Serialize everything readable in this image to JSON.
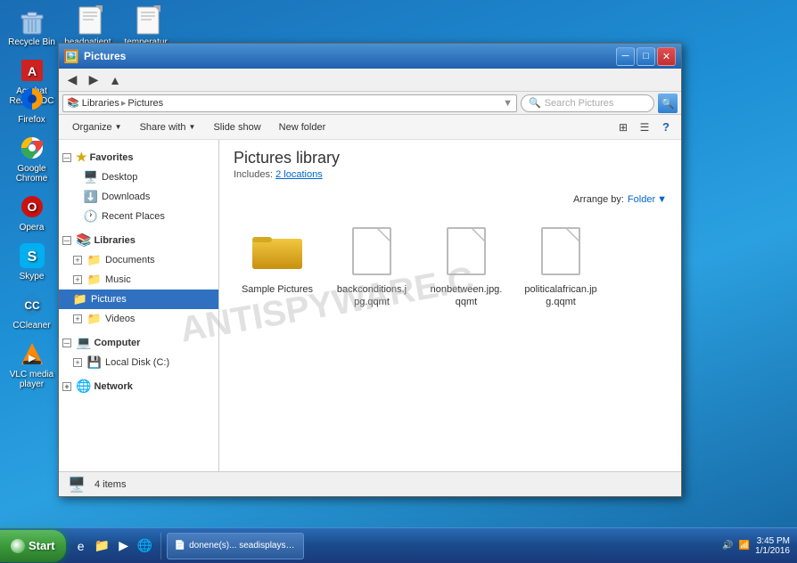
{
  "desktop": {
    "icons": [
      {
        "id": "recycle-bin",
        "label": "Recycle Bin",
        "icon": "🗑️",
        "color": "#a0c4e8"
      },
      {
        "id": "acrobat",
        "label": "Acrobat Reader DC",
        "icon": "📄",
        "color": "#ff4444"
      },
      {
        "id": "headpatient",
        "label": "headpatient...",
        "icon": "📄",
        "color": "#e0e0e0"
      },
      {
        "id": "temperature",
        "label": "temperatur...",
        "icon": "📄",
        "color": "#e0e0e0"
      },
      {
        "id": "firefox",
        "label": "Firefox",
        "icon": "🦊",
        "color": "#ff6600"
      },
      {
        "id": "chrome",
        "label": "Google Chrome",
        "icon": "🌐",
        "color": "#4285f4"
      },
      {
        "id": "opera",
        "label": "Opera",
        "icon": "O",
        "color": "#cc1111"
      },
      {
        "id": "skype",
        "label": "Skype",
        "icon": "S",
        "color": "#00aff0"
      },
      {
        "id": "ccleaner",
        "label": "CCleaner",
        "icon": "C",
        "color": "#2288cc"
      },
      {
        "id": "vlc",
        "label": "VLC media player",
        "icon": "▶",
        "color": "#ff8800"
      }
    ]
  },
  "taskbar": {
    "start_label": "Start",
    "items": [
      {
        "id": "ie-icon",
        "label": "Internet Explorer",
        "icon": "e"
      },
      {
        "id": "folder-icon",
        "label": "Windows Explorer",
        "icon": "📁"
      },
      {
        "id": "wmp-icon",
        "label": "Windows Media Player",
        "icon": "▶"
      },
      {
        "id": "chrome-icon",
        "label": "Chrome",
        "icon": "●"
      }
    ],
    "taskbar_windows": [
      {
        "id": "donene",
        "label": "donene(s)... seadisplays.j..."
      }
    ],
    "clock": "3:45 PM",
    "date": "1/1/2016"
  },
  "window": {
    "title": "Pictures",
    "titlebar_icon": "🖼️",
    "controls": {
      "minimize": "─",
      "maximize": "□",
      "close": "✕"
    },
    "address": {
      "label": "",
      "path": "Libraries ▸ Pictures",
      "path_parts": [
        "Libraries",
        "Pictures"
      ],
      "search_placeholder": "Search Pictures"
    },
    "toolbar": {
      "organize": "Organize",
      "share_with": "Share with",
      "slide_show": "Slide show",
      "new_folder": "New folder"
    },
    "library": {
      "title": "Pictures library",
      "includes_label": "Includes:",
      "includes_count": "2 locations"
    },
    "arrange": {
      "label": "Arrange by:",
      "value": "Folder"
    },
    "files": [
      {
        "id": "sample-pictures",
        "name": "Sample Pictures",
        "type": "folder"
      },
      {
        "id": "backconditions",
        "name": "backconditions.jpg.qqmt",
        "type": "file"
      },
      {
        "id": "nonbetween",
        "name": "nonbetween.jpg.qqmt",
        "type": "file"
      },
      {
        "id": "politicalafrican",
        "name": "politicalafrican.jpg.qqmt",
        "type": "file"
      }
    ],
    "status": {
      "icon": "🖥️",
      "count_label": "4 items"
    }
  },
  "sidebar": {
    "favorites": {
      "label": "Favorites",
      "items": [
        {
          "id": "desktop",
          "label": "Desktop",
          "icon": "🖥️"
        },
        {
          "id": "downloads",
          "label": "Downloads",
          "icon": "⬇️"
        },
        {
          "id": "recent-places",
          "label": "Recent Places",
          "icon": "🕐"
        }
      ]
    },
    "libraries": {
      "label": "Libraries",
      "items": [
        {
          "id": "documents",
          "label": "Documents",
          "icon": "📁",
          "expandable": true
        },
        {
          "id": "music",
          "label": "Music",
          "icon": "📁",
          "expandable": true
        },
        {
          "id": "pictures",
          "label": "Pictures",
          "icon": "📁",
          "selected": true
        },
        {
          "id": "videos",
          "label": "Videos",
          "icon": "📁",
          "expandable": true
        }
      ]
    },
    "computer": {
      "label": "Computer",
      "items": [
        {
          "id": "local-disk",
          "label": "Local Disk (C:)",
          "icon": "💾",
          "expandable": true
        }
      ]
    },
    "network": {
      "label": "Network"
    }
  },
  "watermark": {
    "text": "ANTISPYWARE.C"
  }
}
